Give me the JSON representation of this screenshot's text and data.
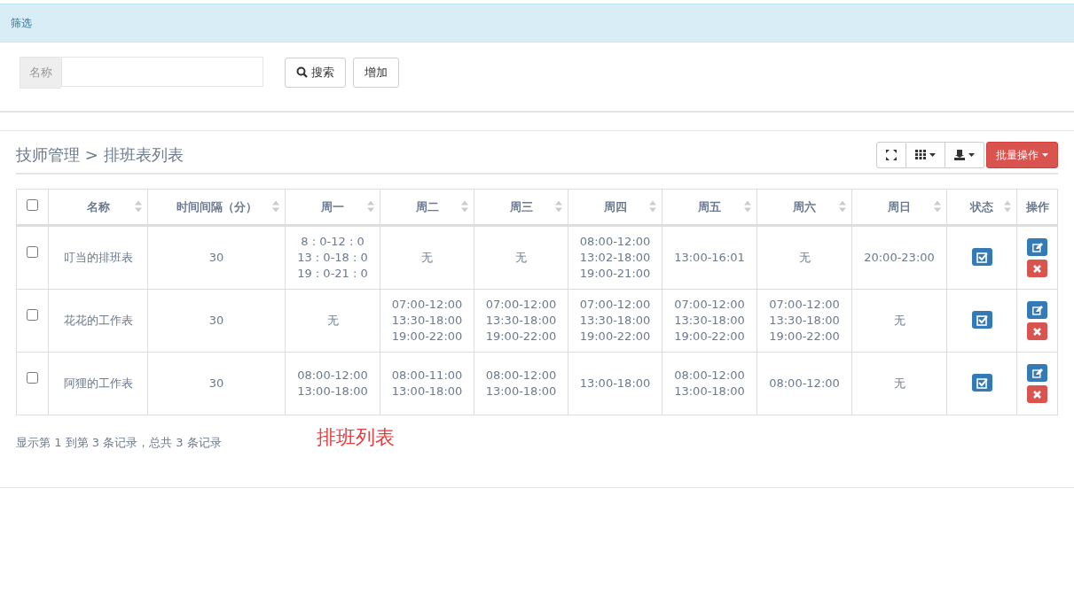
{
  "filter_panel": {
    "title": "筛选",
    "name_field": {
      "label": "名称"
    },
    "buttons": [
      {
        "kind": "search",
        "label": "搜索"
      },
      {
        "kind": "plain",
        "label": "增加"
      }
    ]
  },
  "breadcrumb": "技师管理 > 排班表列表",
  "toolbar": {
    "buttons": [
      {
        "kind": "fullscreen",
        "caret": false
      },
      {
        "kind": "columns",
        "caret": true
      },
      {
        "kind": "export",
        "caret": true
      }
    ],
    "batch_button": "批量操作"
  },
  "table": {
    "select_all": {
      "checked": false
    },
    "columns": [
      {
        "label": "名称",
        "sortable": true
      },
      {
        "label": "时间间隔（分）",
        "sortable": true
      },
      {
        "label": "周一",
        "sortable": true
      },
      {
        "label": "周二",
        "sortable": true
      },
      {
        "label": "周三",
        "sortable": true
      },
      {
        "label": "周四",
        "sortable": true
      },
      {
        "label": "周五",
        "sortable": true
      },
      {
        "label": "周六",
        "sortable": true
      },
      {
        "label": "周日",
        "sortable": true
      },
      {
        "label": "状态",
        "sortable": true
      },
      {
        "label": "操作",
        "sortable": false
      }
    ],
    "rows": [
      {
        "checked": false,
        "name": "叮当的排班表",
        "interval": "30",
        "days": [
          [
            "8 : 0-12 : 0",
            "13 : 0-18 : 0",
            "19 : 0-21 : 0"
          ],
          [
            "无"
          ],
          [
            "无"
          ],
          [
            "08:00-12:00",
            "13:02-18:00",
            "19:00-21:00"
          ],
          [
            "13:00-16:01"
          ],
          [
            "无"
          ],
          [
            "20:00-23:00"
          ]
        ],
        "status_on": true
      },
      {
        "checked": false,
        "name": "花花的工作表",
        "interval": "30",
        "days": [
          [
            "无"
          ],
          [
            "07:00-12:00",
            "13:30-18:00",
            "19:00-22:00"
          ],
          [
            "07:00-12:00",
            "13:30-18:00",
            "19:00-22:00"
          ],
          [
            "07:00-12:00",
            "13:30-18:00",
            "19:00-22:00"
          ],
          [
            "07:00-12:00",
            "13:30-18:00",
            "19:00-22:00"
          ],
          [
            "07:00-12:00",
            "13:30-18:00",
            "19:00-22:00"
          ],
          [
            "无"
          ]
        ],
        "status_on": true
      },
      {
        "checked": false,
        "name": "阿狸的工作表",
        "interval": "30",
        "days": [
          [
            "08:00-12:00",
            "13:00-18:00"
          ],
          [
            "08:00-11:00",
            "13:00-18:00"
          ],
          [
            "08:00-12:00",
            "13:00-18:00"
          ],
          [
            "13:00-18:00"
          ],
          [
            "08:00-12:00",
            "13:00-18:00"
          ],
          [
            "08:00-12:00"
          ],
          [
            "无"
          ]
        ],
        "status_on": true
      }
    ]
  },
  "pagination_info": "显示第 1 到第 3 条记录，总共 3 条记录",
  "caption": "排班列表"
}
